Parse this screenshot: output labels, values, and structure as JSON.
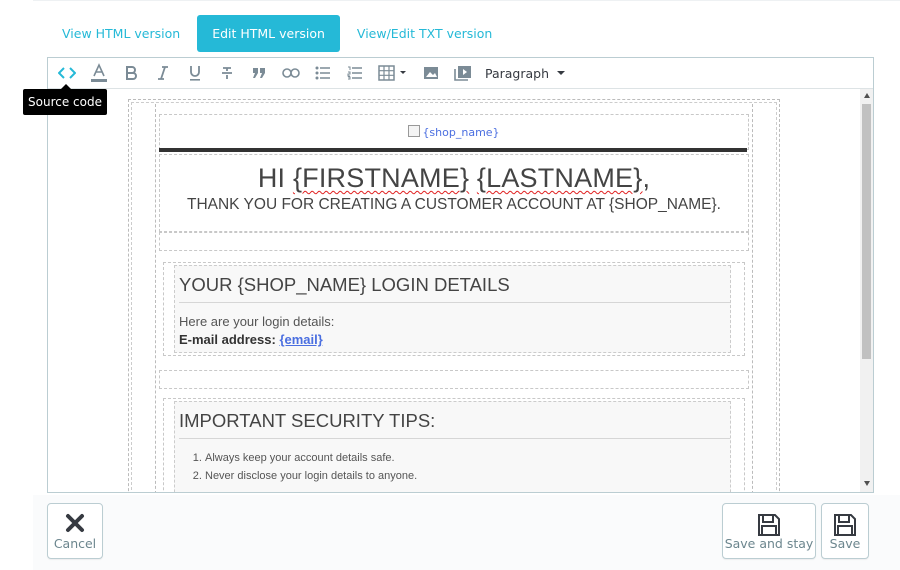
{
  "tabs": [
    {
      "label": "View HTML version",
      "active": false
    },
    {
      "label": "Edit HTML version",
      "active": true
    },
    {
      "label": "View/Edit TXT version",
      "active": false
    }
  ],
  "toolbar": {
    "tooltip": "Source code",
    "format_select": "Paragraph",
    "icons": [
      "source-code",
      "text-color",
      "bold",
      "italic",
      "underline",
      "strikethrough",
      "blockquote",
      "link",
      "bullet-list",
      "numbered-list",
      "table",
      "image",
      "media"
    ]
  },
  "email": {
    "logo_alt": "{shop_name}",
    "greeting_prefix": "HI ",
    "firstname": "{FIRSTNAME}",
    "lastname": "{LASTNAME}",
    "greeting_suffix": ",",
    "thanks": "THANK YOU FOR CREATING A CUSTOMER ACCOUNT AT {SHOP_NAME}.",
    "login_box": {
      "title": "YOUR {SHOP_NAME} LOGIN DETAILS",
      "intro": "Here are your login details:",
      "email_label": "E-mail address:",
      "email_value": "{email}"
    },
    "security_box": {
      "title": "IMPORTANT SECURITY TIPS:",
      "tips": [
        "Always keep your account details safe.",
        "Never disclose your login details to anyone."
      ]
    }
  },
  "footer": {
    "cancel_label": "Cancel",
    "save_stay_label": "Save and stay",
    "save_label": "Save"
  },
  "colors": {
    "accent": "#25b9d7",
    "text": "#363a41",
    "border": "#bbcdd2"
  }
}
